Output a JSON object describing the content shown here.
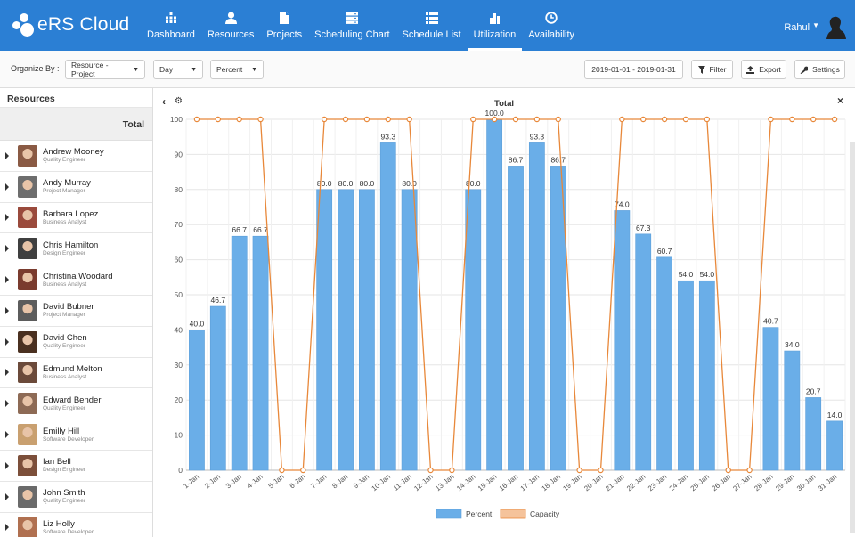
{
  "app": {
    "brand": "eRS Cloud"
  },
  "nav": {
    "items": [
      {
        "label": "Dashboard",
        "icon": "dashboard-icon"
      },
      {
        "label": "Resources",
        "icon": "user-icon"
      },
      {
        "label": "Projects",
        "icon": "file-icon"
      },
      {
        "label": "Scheduling Chart",
        "icon": "server-icon"
      },
      {
        "label": "Schedule List",
        "icon": "list-icon"
      },
      {
        "label": "Utilization",
        "icon": "bar-chart-icon",
        "active": true
      },
      {
        "label": "Availability",
        "icon": "clock-icon"
      }
    ],
    "user": "Rahul"
  },
  "toolbar": {
    "organize_label": "Organize By :",
    "organize_value": "Resource - Project",
    "period_value": "Day",
    "measure_value": "Percent",
    "date_range": "2019-01-01 - 2019-01-31",
    "filter_label": "Filter",
    "export_label": "Export",
    "settings_label": "Settings"
  },
  "sidebar": {
    "title": "Resources",
    "total_label": "Total",
    "resources": [
      {
        "name": "Andrew Mooney",
        "role": "Quality Engineer"
      },
      {
        "name": "Andy Murray",
        "role": "Project Manager"
      },
      {
        "name": "Barbara Lopez",
        "role": "Business Analyst"
      },
      {
        "name": "Chris Hamilton",
        "role": "Design Engineer"
      },
      {
        "name": "Christina Woodard",
        "role": "Business Analyst"
      },
      {
        "name": "David Bubner",
        "role": "Project Manager"
      },
      {
        "name": "David Chen",
        "role": "Quality Engineer"
      },
      {
        "name": "Edmund Melton",
        "role": "Business Analyst"
      },
      {
        "name": "Edward Bender",
        "role": "Quality Engineer"
      },
      {
        "name": "Emilly Hill",
        "role": "Software Developer"
      },
      {
        "name": "Ian Bell",
        "role": "Design Engineer"
      },
      {
        "name": "John Smith",
        "role": "Quality Engineer"
      },
      {
        "name": "Liz Holly",
        "role": "Software Developer"
      }
    ]
  },
  "panel": {
    "title": "Total"
  },
  "chart_data": {
    "type": "bar",
    "title": "Total",
    "categories": [
      "1-Jan",
      "2-Jan",
      "3-Jan",
      "4-Jan",
      "5-Jan",
      "6-Jan",
      "7-Jan",
      "8-Jan",
      "9-Jan",
      "10-Jan",
      "11-Jan",
      "12-Jan",
      "13-Jan",
      "14-Jan",
      "15-Jan",
      "16-Jan",
      "17-Jan",
      "18-Jan",
      "19-Jan",
      "20-Jan",
      "21-Jan",
      "22-Jan",
      "23-Jan",
      "24-Jan",
      "25-Jan",
      "26-Jan",
      "27-Jan",
      "28-Jan",
      "29-Jan",
      "30-Jan",
      "31-Jan"
    ],
    "series": [
      {
        "name": "Percent",
        "type": "bar",
        "color": "#6aaee8",
        "values": [
          40.0,
          46.7,
          66.7,
          66.7,
          0,
          0,
          80.0,
          80.0,
          80.0,
          93.3,
          80.0,
          0,
          0,
          80.0,
          100.0,
          86.7,
          93.3,
          86.7,
          0,
          0,
          74.0,
          67.3,
          60.7,
          54.0,
          54.0,
          0,
          0,
          40.7,
          34.0,
          20.7,
          14.0
        ]
      },
      {
        "name": "Capacity",
        "type": "line",
        "color": "#e8883a",
        "values": [
          100,
          100,
          100,
          100,
          0,
          0,
          100,
          100,
          100,
          100,
          100,
          0,
          0,
          100,
          100,
          100,
          100,
          100,
          0,
          0,
          100,
          100,
          100,
          100,
          100,
          0,
          0,
          100,
          100,
          100,
          100
        ]
      }
    ],
    "ylim": [
      0,
      100
    ],
    "yticks": [
      0,
      10,
      20,
      30,
      40,
      50,
      60,
      70,
      80,
      90,
      100
    ],
    "grid": true,
    "legend_position": "bottom"
  }
}
